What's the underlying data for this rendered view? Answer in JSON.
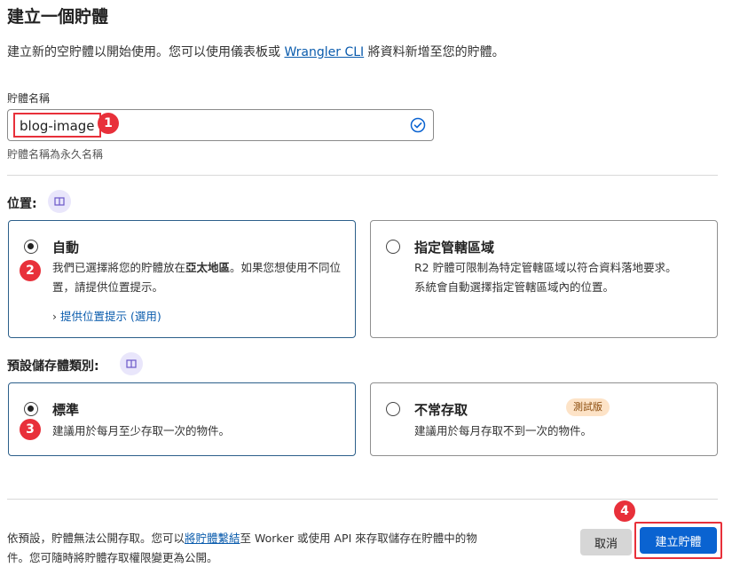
{
  "header": {
    "title": "建立一個貯體",
    "intro_before": "建立新的空貯體以開始使用。您可以使用儀表板或",
    "intro_link": "Wrangler CLI",
    "intro_after": "將資料新增至您的貯體。"
  },
  "bucket_name": {
    "label": "貯體名稱",
    "value": "blog-image",
    "hint": "貯體名稱為永久名稱"
  },
  "location": {
    "label": "位置:",
    "options": [
      {
        "title": "自動",
        "selected": true,
        "desc_before": "我們已選擇將您的貯體放在",
        "desc_bold": "亞太地區",
        "desc_after": "。如果您想使用不同位置，請提供位置提示。",
        "link": "提供位置提示 (選用)"
      },
      {
        "title": "指定管轄區域",
        "selected": false,
        "desc": "R2 貯體可限制為特定管轄區域以符合資料落地要求。系統會自動選擇指定管轄區域內的位置。"
      }
    ]
  },
  "storage_class": {
    "label": "預設儲存體類別:",
    "options": [
      {
        "title": "標準",
        "selected": true,
        "desc": "建議用於每月至少存取一次的物件。"
      },
      {
        "title": "不常存取",
        "selected": false,
        "badge": "測試版",
        "desc": "建議用於每月存取不到一次的物件。"
      }
    ]
  },
  "footer": {
    "text_before": "依預設，貯體無法公開存取。您可以",
    "text_link": "將貯體繫結",
    "text_after": "至 Worker 或使用 API 來存取儲存在貯體中的物件。您可隨時將貯體存取權限變更為公開。",
    "cancel_label": "取消",
    "create_label": "建立貯體"
  },
  "annotations": {
    "step1": "1",
    "step2": "2",
    "step3": "3",
    "step4": "4"
  },
  "colors": {
    "accent": "#0a63d1",
    "annotation_red": "#e8303a",
    "link": "#0b5cad",
    "badge_bg": "#fde3c7"
  }
}
